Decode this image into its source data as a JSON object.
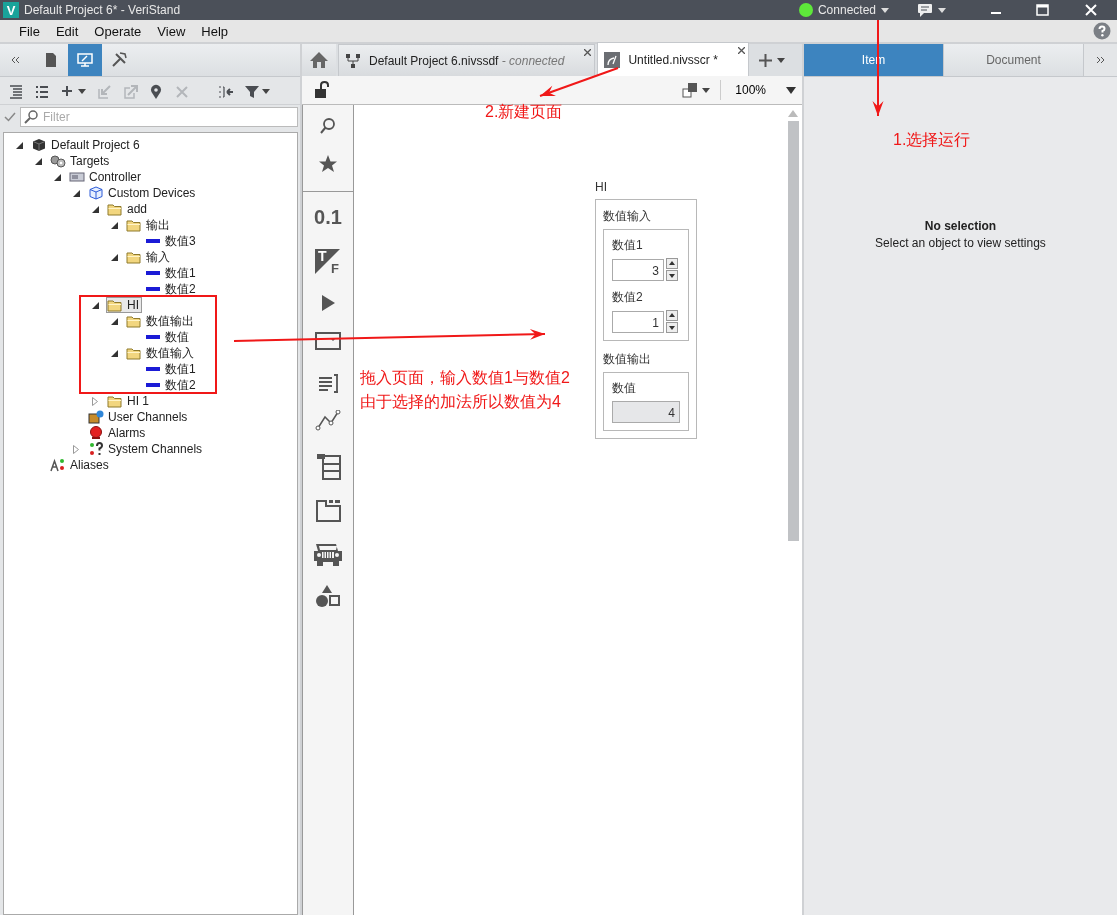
{
  "window": {
    "logo": "V",
    "title": "Default Project 6* - VeriStand",
    "connection": {
      "label": "Connected",
      "on": true
    }
  },
  "menu": [
    "File",
    "Edit",
    "Operate",
    "View",
    "Help"
  ],
  "left_panel": {
    "view_tabs": [
      {
        "kind": "document",
        "selected": false
      },
      {
        "kind": "screen",
        "selected": true
      },
      {
        "kind": "tools",
        "selected": false
      }
    ],
    "toolbar": [
      {
        "kind": "expand-all",
        "disabled": false
      },
      {
        "kind": "collapse-all",
        "disabled": false
      },
      {
        "kind": "add",
        "disabled": false
      },
      {
        "kind": "import",
        "disabled": true
      },
      {
        "kind": "export",
        "disabled": true
      },
      {
        "kind": "locate",
        "disabled": false
      },
      {
        "kind": "delete",
        "disabled": true
      },
      {
        "kind": "merge",
        "disabled": false
      },
      {
        "kind": "filter",
        "disabled": false
      }
    ],
    "filter": {
      "placeholder": "Filter"
    },
    "tree": [
      {
        "label": "Default Project 6",
        "kind": "project",
        "expanded": true,
        "selected": false,
        "children": [
          {
            "label": "Targets",
            "kind": "targets",
            "expanded": true,
            "selected": false,
            "children": [
              {
                "label": "Controller",
                "kind": "controller",
                "expanded": true,
                "selected": false,
                "children": [
                  {
                    "label": "Custom Devices",
                    "kind": "custom_devices",
                    "expanded": true,
                    "selected": false,
                    "children": [
                      {
                        "label": "add",
                        "kind": "folder",
                        "expanded": true,
                        "selected": false,
                        "children": [
                          {
                            "label": "输出",
                            "kind": "folder",
                            "expanded": true,
                            "selected": false,
                            "children": [
                              {
                                "label": "数值3",
                                "kind": "channel",
                                "selected": false
                              }
                            ]
                          },
                          {
                            "label": "输入",
                            "kind": "folder",
                            "expanded": true,
                            "selected": false,
                            "children": [
                              {
                                "label": "数值1",
                                "kind": "channel",
                                "selected": false
                              },
                              {
                                "label": "数值2",
                                "kind": "channel",
                                "selected": false
                              }
                            ]
                          }
                        ]
                      },
                      {
                        "label": "HI",
                        "kind": "folder",
                        "expanded": true,
                        "selected": true,
                        "children": [
                          {
                            "label": "数值输出",
                            "kind": "folder",
                            "expanded": true,
                            "selected": false,
                            "children": [
                              {
                                "label": "数值",
                                "kind": "channel",
                                "selected": false
                              }
                            ]
                          },
                          {
                            "label": "数值输入",
                            "kind": "folder",
                            "expanded": true,
                            "selected": false,
                            "children": [
                              {
                                "label": "数值1",
                                "kind": "channel",
                                "selected": false
                              },
                              {
                                "label": "数值2",
                                "kind": "channel",
                                "selected": false
                              }
                            ]
                          }
                        ]
                      },
                      {
                        "label": "HI 1",
                        "kind": "folder",
                        "expanded": false,
                        "selected": false
                      }
                    ]
                  },
                  {
                    "label": "User Channels",
                    "kind": "user_channels",
                    "selected": false
                  },
                  {
                    "label": "Alarms",
                    "kind": "alarms",
                    "selected": false
                  },
                  {
                    "label": "System Channels",
                    "kind": "system_channels",
                    "expanded": false,
                    "selected": false
                  }
                ]
              }
            ]
          },
          {
            "label": "Aliases",
            "kind": "aliases",
            "selected": false
          }
        ]
      }
    ]
  },
  "document_tabs": [
    {
      "label": "Default Project 6.nivssdf",
      "status": "- connected",
      "kind": "system",
      "selected": false
    },
    {
      "label": "Untitled.nivsscr *",
      "kind": "screen",
      "selected": true
    }
  ],
  "zoom": "100%",
  "palette": [
    {
      "kind": "search"
    },
    {
      "kind": "favorites"
    },
    {
      "kind": "numeric",
      "glyph": "0.1"
    },
    {
      "kind": "boolean",
      "glyph": "T",
      "glyph_2": "F"
    },
    {
      "kind": "play"
    },
    {
      "kind": "dropdown"
    },
    {
      "kind": "text"
    },
    {
      "kind": "graph"
    },
    {
      "kind": "table"
    },
    {
      "kind": "tab"
    },
    {
      "kind": "vehicle"
    },
    {
      "kind": "shapes"
    }
  ],
  "canvas": {
    "group_title": "HI",
    "sections": [
      {
        "title": "数值输入",
        "controls": [
          {
            "label": "数值1",
            "value": "3",
            "kind": "control"
          },
          {
            "label": "数值2",
            "value": "1",
            "kind": "control"
          }
        ]
      },
      {
        "title": "数值输出",
        "controls": [
          {
            "label": "数值",
            "value": "4",
            "kind": "indicator"
          }
        ]
      }
    ]
  },
  "properties": {
    "tabs": [
      {
        "label": "Item",
        "selected": true
      },
      {
        "label": "Document",
        "selected": false
      }
    ],
    "empty_title": "No selection",
    "empty_hint": "Select an object to view settings"
  },
  "annotations": [
    "2.新建页面",
    "1.选择运行",
    "拖入页面，输入数值1与数值2",
    "由于选择的加法所以数值为4"
  ]
}
